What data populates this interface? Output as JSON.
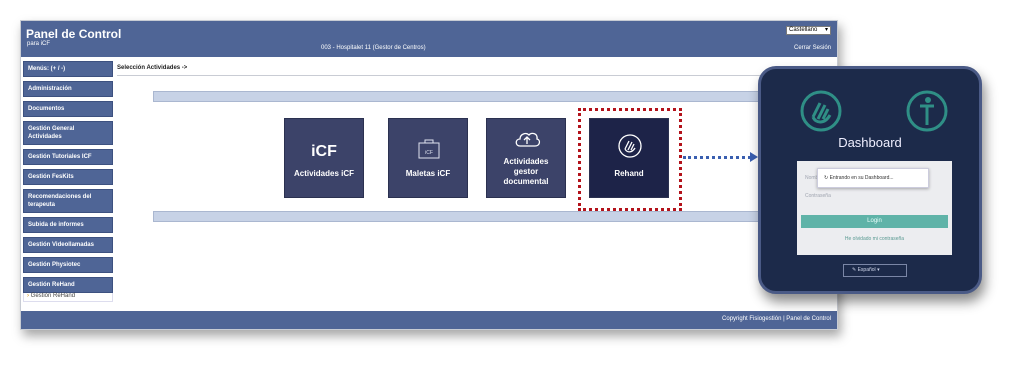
{
  "header": {
    "title": "Panel de Control",
    "subtitle": "para iCF",
    "center": "003 - Hospitalet 11 (Gestor de Centros)",
    "language": "Castellano",
    "logout": "Cerrar Sesión"
  },
  "sidebar": {
    "items": [
      "Menús: (+ / -)",
      "Administración",
      "Documentos",
      "Gestión General Actividades",
      "Gestión Tutoriales ICF",
      "Gestión FesKits",
      "Recomendaciones del terapeuta",
      "Subida de informes",
      "Gestión Videollamadas",
      "Gestión Physiotec",
      "Gestión ReHand"
    ],
    "sub_item": "Gestión ReHand"
  },
  "breadcrumb": "Selección Actividades ->",
  "tiles": {
    "icf_logo": "iCF",
    "icf_label": "Actividades iCF",
    "maletas_icon_text": "iCF",
    "maletas_label": "Maletas iCF",
    "gestor_label_1": "Actividades",
    "gestor_label_2": "gestor",
    "gestor_label_3": "documental",
    "rehand_label": "Rehand"
  },
  "footer": {
    "copyright": "Copyright Fisiogestión | Panel de Control"
  },
  "dashboard": {
    "title": "Dashboard",
    "field_user": "Nombre",
    "field_pass": "Contraseña",
    "toast": "Entrando en su Dashboard...",
    "login": "Login",
    "forgot": "He olvidado mi contraseña",
    "language": "Español"
  },
  "colors": {
    "header": "#4f6596",
    "tile": "#3c4369",
    "highlight": "#b3121a",
    "arrow": "#3a5fb0",
    "login": "#5fb3a8"
  },
  "icons": [
    "chevron-down-icon",
    "suitcase-icon",
    "cloud-upload-icon",
    "hand-icon",
    "person-icon",
    "spinner-icon"
  ]
}
